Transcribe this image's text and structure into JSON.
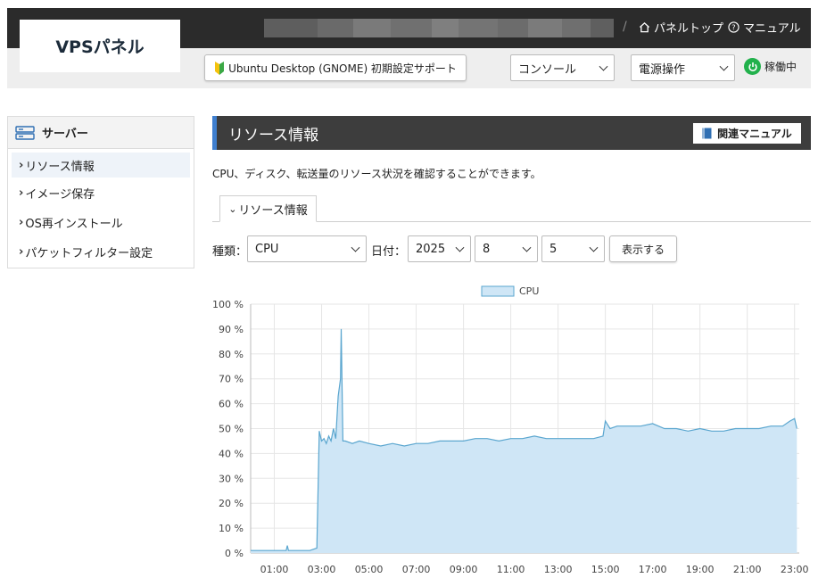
{
  "header": {
    "logo": "VPSパネル",
    "panel_top": "パネルトップ",
    "manual": "マニュアル",
    "separator": "/",
    "guide_button": "Ubuntu Desktop (GNOME) 初期設定サポート",
    "console_select": "コンソール",
    "power_select": "電源操作",
    "status": "稼働中",
    "mask_colors": [
      "#5e5e5e",
      "#6a6a6a",
      "#7a7a7a",
      "#707070",
      "#7f7f7f",
      "#747474",
      "#6c6c6c",
      "#7b7b7b",
      "#6f6f6f",
      "#5f5f5f"
    ]
  },
  "sidebar": {
    "title": "サーバー",
    "items": [
      {
        "label": "リソース情報",
        "active": true
      },
      {
        "label": "イメージ保存",
        "active": false
      },
      {
        "label": "OS再インストール",
        "active": false
      },
      {
        "label": "パケットフィルター設定",
        "active": false
      }
    ]
  },
  "main": {
    "title": "リソース情報",
    "manual_button": "関連マニュアル",
    "description": "CPU、ディスク、転送量のリソース状況を確認することができます。",
    "tab": "リソース情報",
    "form": {
      "type_label": "種類：",
      "type_value": "CPU",
      "date_label": "日付：",
      "year": "2025",
      "month": "8",
      "day": "5",
      "show_button": "表示する"
    }
  },
  "colors": {
    "accent": "#3f7fcf",
    "status_green": "#22b14c",
    "series_line": "#5aa6cf",
    "series_fill": "#cfe6f6"
  },
  "chart_data": {
    "type": "area",
    "legend": "CPU",
    "legend_position": "top-center",
    "grid": true,
    "ylim": [
      0,
      100
    ],
    "xlim": [
      0,
      23.2
    ],
    "yticks": [
      "0 %",
      "10 %",
      "20 %",
      "30 %",
      "40 %",
      "50 %",
      "60 %",
      "70 %",
      "80 %",
      "90 %",
      "100 %"
    ],
    "xticks": [
      {
        "label": "01:00",
        "h": 1
      },
      {
        "label": "03:00",
        "h": 3
      },
      {
        "label": "05:00",
        "h": 5
      },
      {
        "label": "07:00",
        "h": 7
      },
      {
        "label": "09:00",
        "h": 9
      },
      {
        "label": "11:00",
        "h": 11
      },
      {
        "label": "13:00",
        "h": 13
      },
      {
        "label": "15:00",
        "h": 15
      },
      {
        "label": "17:00",
        "h": 17
      },
      {
        "label": "19:00",
        "h": 19
      },
      {
        "label": "21:00",
        "h": 21
      },
      {
        "label": "23:00",
        "h": 23
      }
    ],
    "series": [
      {
        "name": "CPU",
        "points": [
          [
            0.0,
            1
          ],
          [
            0.5,
            1
          ],
          [
            1.0,
            1
          ],
          [
            1.5,
            1
          ],
          [
            1.55,
            3
          ],
          [
            1.6,
            1
          ],
          [
            2.0,
            1
          ],
          [
            2.5,
            1
          ],
          [
            2.8,
            2
          ],
          [
            2.9,
            49
          ],
          [
            3.0,
            45
          ],
          [
            3.1,
            46
          ],
          [
            3.2,
            44
          ],
          [
            3.3,
            47
          ],
          [
            3.4,
            45
          ],
          [
            3.5,
            50
          ],
          [
            3.6,
            46
          ],
          [
            3.7,
            63
          ],
          [
            3.8,
            70
          ],
          [
            3.83,
            90
          ],
          [
            3.9,
            45
          ],
          [
            4.0,
            45
          ],
          [
            4.3,
            44
          ],
          [
            4.6,
            45
          ],
          [
            5.0,
            44
          ],
          [
            5.5,
            43
          ],
          [
            6.0,
            44
          ],
          [
            6.5,
            43
          ],
          [
            7.0,
            44
          ],
          [
            7.5,
            44
          ],
          [
            8.0,
            45
          ],
          [
            8.5,
            45
          ],
          [
            9.0,
            45
          ],
          [
            9.5,
            46
          ],
          [
            10.0,
            46
          ],
          [
            10.5,
            45
          ],
          [
            11.0,
            46
          ],
          [
            11.5,
            46
          ],
          [
            12.0,
            47
          ],
          [
            12.5,
            46
          ],
          [
            13.0,
            46
          ],
          [
            13.5,
            46
          ],
          [
            14.0,
            46
          ],
          [
            14.5,
            46
          ],
          [
            14.9,
            47
          ],
          [
            15.0,
            53
          ],
          [
            15.2,
            50
          ],
          [
            15.5,
            51
          ],
          [
            16.0,
            51
          ],
          [
            16.5,
            51
          ],
          [
            17.0,
            52
          ],
          [
            17.5,
            50
          ],
          [
            18.0,
            50
          ],
          [
            18.5,
            49
          ],
          [
            19.0,
            50
          ],
          [
            19.5,
            49
          ],
          [
            20.0,
            49
          ],
          [
            20.5,
            50
          ],
          [
            21.0,
            50
          ],
          [
            21.5,
            50
          ],
          [
            22.0,
            51
          ],
          [
            22.5,
            51
          ],
          [
            22.8,
            53
          ],
          [
            23.0,
            54
          ],
          [
            23.1,
            50
          ]
        ]
      }
    ]
  }
}
